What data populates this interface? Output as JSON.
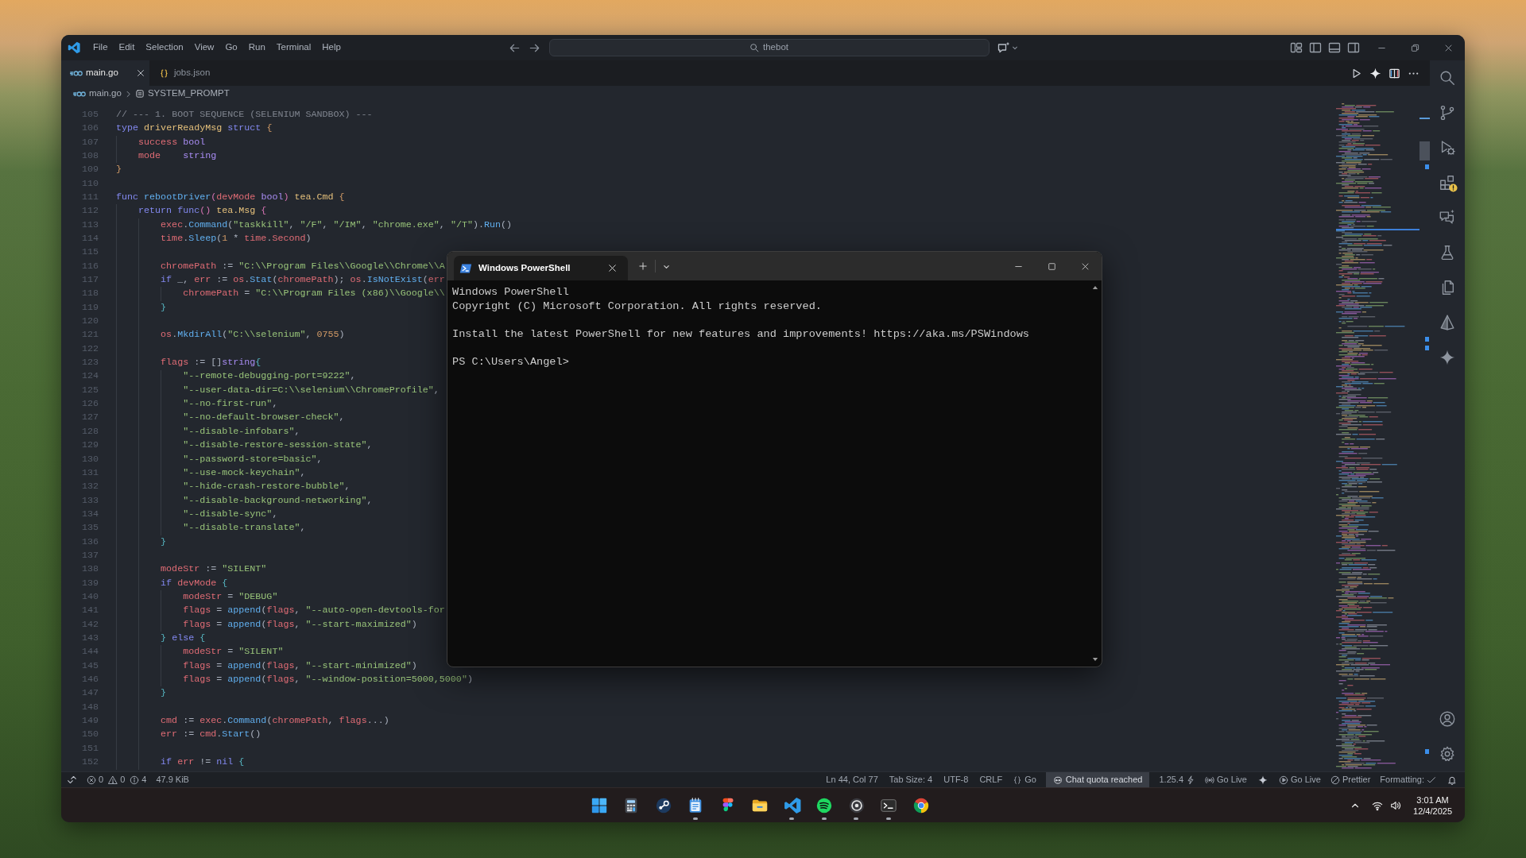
{
  "title_bar": {
    "menu": [
      "File",
      "Edit",
      "Selection",
      "View",
      "Go",
      "Run",
      "Terminal",
      "Help"
    ],
    "command_center": {
      "label": "thebot"
    }
  },
  "tabs": [
    {
      "label": "main.go",
      "kind": "go",
      "selected": true
    },
    {
      "label": "jobs.json",
      "kind": "json",
      "selected": false
    }
  ],
  "breadcrumb": [
    {
      "label": "main.go",
      "kind": "go"
    },
    {
      "label": "SYSTEM_PROMPT",
      "kind": "symbol"
    }
  ],
  "editor": {
    "lines": [
      {
        "number": "105",
        "tokens": [
          {
            "kind": "comment",
            "text": "// --- 1. BOOT SEQUENCE (SELENIUM SANDBOX) ---"
          }
        ]
      },
      {
        "number": "106",
        "tokens": [
          {
            "kind": "keyword",
            "text": "type "
          },
          {
            "kind": "type",
            "text": "driverReadyMsg "
          },
          {
            "kind": "keyword",
            "text": "struct "
          },
          {
            "kind": "bracket1",
            "text": "{"
          }
        ]
      },
      {
        "number": "107",
        "tokens": [
          {
            "kind": "variable",
            "text": "    success "
          },
          {
            "kind": "builtin",
            "text": "bool"
          }
        ]
      },
      {
        "number": "108",
        "tokens": [
          {
            "kind": "variable",
            "text": "    mode    "
          },
          {
            "kind": "builtin",
            "text": "string"
          }
        ]
      },
      {
        "number": "109",
        "tokens": [
          {
            "kind": "bracket1",
            "text": "}"
          }
        ]
      },
      {
        "number": "110"
      },
      {
        "number": "111",
        "tokens": [
          {
            "kind": "keyword",
            "text": "func "
          },
          {
            "kind": "function",
            "text": "rebootDriver"
          },
          {
            "kind": "bracket2",
            "text": "("
          },
          {
            "kind": "variable",
            "text": "devMode "
          },
          {
            "kind": "builtin",
            "text": "bool"
          },
          {
            "kind": "bracket2",
            "text": ") "
          },
          {
            "kind": "type",
            "text": "tea.Cmd "
          },
          {
            "kind": "bracket1",
            "text": "{"
          }
        ]
      },
      {
        "number": "112",
        "tokens": [
          {
            "kind": "keyword",
            "text": "    return func"
          },
          {
            "kind": "bracket2",
            "text": "() "
          },
          {
            "kind": "type",
            "text": "tea.Msg "
          },
          {
            "kind": "bracket2",
            "text": "{"
          }
        ]
      },
      {
        "number": "113",
        "tokens": [
          {
            "kind": "variable",
            "text": "        exec"
          },
          {
            "kind": "punctuation",
            "text": "."
          },
          {
            "kind": "function",
            "text": "Command"
          },
          {
            "kind": "punctuation",
            "text": "("
          },
          {
            "kind": "string",
            "text": "\"taskkill\""
          },
          {
            "kind": "punctuation",
            "text": ", "
          },
          {
            "kind": "string",
            "text": "\"/F\""
          },
          {
            "kind": "punctuation",
            "text": ", "
          },
          {
            "kind": "string",
            "text": "\"/IM\""
          },
          {
            "kind": "punctuation",
            "text": ", "
          },
          {
            "kind": "string",
            "text": "\"chrome.exe\""
          },
          {
            "kind": "punctuation",
            "text": ", "
          },
          {
            "kind": "string",
            "text": "\"/T\""
          },
          {
            "kind": "punctuation",
            "text": ")."
          },
          {
            "kind": "function",
            "text": "Run"
          },
          {
            "kind": "punctuation",
            "text": "()"
          }
        ]
      },
      {
        "number": "114",
        "tokens": [
          {
            "kind": "variable",
            "text": "        time"
          },
          {
            "kind": "punctuation",
            "text": "."
          },
          {
            "kind": "function",
            "text": "Sleep"
          },
          {
            "kind": "punctuation",
            "text": "("
          },
          {
            "kind": "number",
            "text": "1"
          },
          {
            "kind": "punctuation",
            "text": " * "
          },
          {
            "kind": "variable",
            "text": "time"
          },
          {
            "kind": "punctuation",
            "text": "."
          },
          {
            "kind": "variable",
            "text": "Second"
          },
          {
            "kind": "punctuation",
            "text": ")"
          }
        ]
      },
      {
        "number": "115"
      },
      {
        "number": "116",
        "tokens": [
          {
            "kind": "variable",
            "text": "        chromePath "
          },
          {
            "kind": "punctuation",
            "text": ":= "
          },
          {
            "kind": "string",
            "text": "\"C:\\\\Program Files\\\\Google\\\\Chrome\\\\A"
          }
        ]
      },
      {
        "number": "117",
        "tokens": [
          {
            "kind": "keyword",
            "text": "        if "
          },
          {
            "kind": "punctuation",
            "text": "_, "
          },
          {
            "kind": "variable",
            "text": "err "
          },
          {
            "kind": "punctuation",
            "text": ":= "
          },
          {
            "kind": "variable",
            "text": "os"
          },
          {
            "kind": "punctuation",
            "text": "."
          },
          {
            "kind": "function",
            "text": "Stat"
          },
          {
            "kind": "punctuation",
            "text": "("
          },
          {
            "kind": "variable",
            "text": "chromePath"
          },
          {
            "kind": "punctuation",
            "text": "); "
          },
          {
            "kind": "variable",
            "text": "os"
          },
          {
            "kind": "punctuation",
            "text": "."
          },
          {
            "kind": "function",
            "text": "IsNotExist"
          },
          {
            "kind": "punctuation",
            "text": "("
          },
          {
            "kind": "variable",
            "text": "err"
          }
        ]
      },
      {
        "number": "118",
        "tokens": [
          {
            "kind": "variable",
            "text": "            chromePath "
          },
          {
            "kind": "punctuation",
            "text": "= "
          },
          {
            "kind": "string",
            "text": "\"C:\\\\Program Files (x86)\\\\Google\\\\"
          }
        ]
      },
      {
        "number": "119",
        "tokens": [
          {
            "kind": "bracket3",
            "text": "        }"
          }
        ]
      },
      {
        "number": "120"
      },
      {
        "number": "121",
        "tokens": [
          {
            "kind": "variable",
            "text": "        os"
          },
          {
            "kind": "punctuation",
            "text": "."
          },
          {
            "kind": "function",
            "text": "MkdirAll"
          },
          {
            "kind": "punctuation",
            "text": "("
          },
          {
            "kind": "string",
            "text": "\"C:\\\\selenium\""
          },
          {
            "kind": "punctuation",
            "text": ", "
          },
          {
            "kind": "number",
            "text": "0755"
          },
          {
            "kind": "punctuation",
            "text": ")"
          }
        ]
      },
      {
        "number": "122"
      },
      {
        "number": "123",
        "tokens": [
          {
            "kind": "variable",
            "text": "        flags "
          },
          {
            "kind": "punctuation",
            "text": ":= []"
          },
          {
            "kind": "builtin",
            "text": "string"
          },
          {
            "kind": "bracket3",
            "text": "{"
          }
        ]
      },
      {
        "number": "124",
        "tokens": [
          {
            "kind": "string",
            "text": "            \"--remote-debugging-port=9222\""
          },
          {
            "kind": "punctuation",
            "text": ","
          }
        ]
      },
      {
        "number": "125",
        "tokens": [
          {
            "kind": "string",
            "text": "            \"--user-data-dir=C:\\\\selenium\\\\ChromeProfile\""
          },
          {
            "kind": "punctuation",
            "text": ","
          }
        ]
      },
      {
        "number": "126",
        "tokens": [
          {
            "kind": "string",
            "text": "            \"--no-first-run\""
          },
          {
            "kind": "punctuation",
            "text": ","
          }
        ]
      },
      {
        "number": "127",
        "tokens": [
          {
            "kind": "string",
            "text": "            \"--no-default-browser-check\""
          },
          {
            "kind": "punctuation",
            "text": ","
          }
        ]
      },
      {
        "number": "128",
        "tokens": [
          {
            "kind": "string",
            "text": "            \"--disable-infobars\""
          },
          {
            "kind": "punctuation",
            "text": ","
          }
        ]
      },
      {
        "number": "129",
        "tokens": [
          {
            "kind": "string",
            "text": "            \"--disable-restore-session-state\""
          },
          {
            "kind": "punctuation",
            "text": ","
          }
        ]
      },
      {
        "number": "130",
        "tokens": [
          {
            "kind": "string",
            "text": "            \"--password-store=basic\""
          },
          {
            "kind": "punctuation",
            "text": ","
          }
        ]
      },
      {
        "number": "131",
        "tokens": [
          {
            "kind": "string",
            "text": "            \"--use-mock-keychain\""
          },
          {
            "kind": "punctuation",
            "text": ","
          }
        ]
      },
      {
        "number": "132",
        "tokens": [
          {
            "kind": "string",
            "text": "            \"--hide-crash-restore-bubble\""
          },
          {
            "kind": "punctuation",
            "text": ","
          }
        ]
      },
      {
        "number": "133",
        "tokens": [
          {
            "kind": "string",
            "text": "            \"--disable-background-networking\""
          },
          {
            "kind": "punctuation",
            "text": ","
          }
        ]
      },
      {
        "number": "134",
        "tokens": [
          {
            "kind": "string",
            "text": "            \"--disable-sync\""
          },
          {
            "kind": "punctuation",
            "text": ","
          }
        ]
      },
      {
        "number": "135",
        "tokens": [
          {
            "kind": "string",
            "text": "            \"--disable-translate\""
          },
          {
            "kind": "punctuation",
            "text": ","
          }
        ]
      },
      {
        "number": "136",
        "tokens": [
          {
            "kind": "bracket3",
            "text": "        }"
          }
        ]
      },
      {
        "number": "137"
      },
      {
        "number": "138",
        "tokens": [
          {
            "kind": "variable",
            "text": "        modeStr "
          },
          {
            "kind": "punctuation",
            "text": ":= "
          },
          {
            "kind": "string",
            "text": "\"SILENT\""
          }
        ]
      },
      {
        "number": "139",
        "tokens": [
          {
            "kind": "keyword",
            "text": "        if "
          },
          {
            "kind": "variable",
            "text": "devMode "
          },
          {
            "kind": "bracket3",
            "text": "{"
          }
        ]
      },
      {
        "number": "140",
        "tokens": [
          {
            "kind": "variable",
            "text": "            modeStr "
          },
          {
            "kind": "punctuation",
            "text": "= "
          },
          {
            "kind": "string",
            "text": "\"DEBUG\""
          }
        ]
      },
      {
        "number": "141",
        "tokens": [
          {
            "kind": "variable",
            "text": "            flags "
          },
          {
            "kind": "punctuation",
            "text": "= "
          },
          {
            "kind": "function",
            "text": "append"
          },
          {
            "kind": "punctuation",
            "text": "("
          },
          {
            "kind": "variable",
            "text": "flags"
          },
          {
            "kind": "punctuation",
            "text": ", "
          },
          {
            "kind": "string",
            "text": "\"--auto-open-devtools-for"
          }
        ]
      },
      {
        "number": "142",
        "tokens": [
          {
            "kind": "variable",
            "text": "            flags "
          },
          {
            "kind": "punctuation",
            "text": "= "
          },
          {
            "kind": "function",
            "text": "append"
          },
          {
            "kind": "punctuation",
            "text": "("
          },
          {
            "kind": "variable",
            "text": "flags"
          },
          {
            "kind": "punctuation",
            "text": ", "
          },
          {
            "kind": "string",
            "text": "\"--start-maximized\""
          },
          {
            "kind": "punctuation",
            "text": ")"
          }
        ]
      },
      {
        "number": "143",
        "tokens": [
          {
            "kind": "bracket3",
            "text": "        } "
          },
          {
            "kind": "keyword",
            "text": "else "
          },
          {
            "kind": "bracket3",
            "text": "{"
          }
        ]
      },
      {
        "number": "144",
        "tokens": [
          {
            "kind": "variable",
            "text": "            modeStr "
          },
          {
            "kind": "punctuation",
            "text": "= "
          },
          {
            "kind": "string",
            "text": "\"SILENT\""
          }
        ]
      },
      {
        "number": "145",
        "tokens": [
          {
            "kind": "variable",
            "text": "            flags "
          },
          {
            "kind": "punctuation",
            "text": "= "
          },
          {
            "kind": "function",
            "text": "append"
          },
          {
            "kind": "punctuation",
            "text": "("
          },
          {
            "kind": "variable",
            "text": "flags"
          },
          {
            "kind": "punctuation",
            "text": ", "
          },
          {
            "kind": "string",
            "text": "\"--start-minimized\""
          },
          {
            "kind": "punctuation",
            "text": ")"
          }
        ]
      },
      {
        "number": "146",
        "tokens": [
          {
            "kind": "variable",
            "text": "            flags "
          },
          {
            "kind": "punctuation",
            "text": "= "
          },
          {
            "kind": "function",
            "text": "append"
          },
          {
            "kind": "punctuation",
            "text": "("
          },
          {
            "kind": "variable",
            "text": "flags"
          },
          {
            "kind": "punctuation",
            "text": ", "
          },
          {
            "kind": "string",
            "text": "\"--window-position=5000,5000\""
          },
          {
            "kind": "punctuation",
            "text": ")"
          }
        ]
      },
      {
        "number": "147",
        "tokens": [
          {
            "kind": "bracket3",
            "text": "        }"
          }
        ]
      },
      {
        "number": "148"
      },
      {
        "number": "149",
        "tokens": [
          {
            "kind": "variable",
            "text": "        cmd "
          },
          {
            "kind": "punctuation",
            "text": ":= "
          },
          {
            "kind": "variable",
            "text": "exec"
          },
          {
            "kind": "punctuation",
            "text": "."
          },
          {
            "kind": "function",
            "text": "Command"
          },
          {
            "kind": "punctuation",
            "text": "("
          },
          {
            "kind": "variable",
            "text": "chromePath"
          },
          {
            "kind": "punctuation",
            "text": ", "
          },
          {
            "kind": "variable",
            "text": "flags"
          },
          {
            "kind": "punctuation",
            "text": "...)"
          }
        ]
      },
      {
        "number": "150",
        "tokens": [
          {
            "kind": "variable",
            "text": "        err "
          },
          {
            "kind": "punctuation",
            "text": ":= "
          },
          {
            "kind": "variable",
            "text": "cmd"
          },
          {
            "kind": "punctuation",
            "text": "."
          },
          {
            "kind": "function",
            "text": "Start"
          },
          {
            "kind": "punctuation",
            "text": "()"
          }
        ]
      },
      {
        "number": "151"
      },
      {
        "number": "152",
        "tokens": [
          {
            "kind": "keyword",
            "text": "        if "
          },
          {
            "kind": "variable",
            "text": "err "
          },
          {
            "kind": "punctuation",
            "text": "!= "
          },
          {
            "kind": "keyword",
            "text": "nil "
          },
          {
            "kind": "bracket3",
            "text": "{"
          }
        ]
      }
    ]
  },
  "terminal_window": {
    "tab": {
      "title": "Windows PowerShell"
    },
    "output": [
      {
        "lines": [
          "Windows PowerShell",
          "Copyright (C) Microsoft Corporation. All rights reserved."
        ]
      },
      {
        "lines": [
          "Install the latest PowerShell for new features and improvements! https://aka.ms/PSWindows"
        ]
      },
      {
        "lines": [
          "PS C:\\Users\\Angel>"
        ]
      }
    ]
  },
  "status_bar": {
    "left": [
      {
        "kind": "remote"
      },
      {
        "kind": "problems",
        "errors": "0",
        "warnings": "0",
        "infos": "4"
      },
      {
        "kind": "text",
        "text": "47.9 KiB"
      }
    ],
    "right": [
      {
        "kind": "text",
        "text": "Ln 44, Col 77"
      },
      {
        "kind": "text",
        "text": "Tab Size: 4"
      },
      {
        "kind": "text",
        "text": "UTF-8"
      },
      {
        "kind": "text",
        "text": "CRLF"
      },
      {
        "kind": "language",
        "text": "Go"
      },
      {
        "kind": "alert",
        "text": "Chat quota reached"
      },
      {
        "kind": "version",
        "text": "1.25.4"
      },
      {
        "kind": "broadcast",
        "text": "Go Live"
      },
      {
        "kind": "sparkle"
      },
      {
        "kind": "server",
        "text": "Go Live"
      },
      {
        "kind": "formatter",
        "text": "Prettier"
      },
      {
        "kind": "formatting",
        "text": "Formatting:"
      },
      {
        "kind": "bell"
      }
    ]
  },
  "taskbar": {
    "apps": [
      {
        "kind": "start",
        "running": false
      },
      {
        "kind": "calculator",
        "running": false
      },
      {
        "kind": "disc",
        "running": false
      },
      {
        "kind": "notepad",
        "running": true
      },
      {
        "kind": "shapes",
        "running": false
      },
      {
        "kind": "folder",
        "running": false
      },
      {
        "kind": "ribbon",
        "running": true
      },
      {
        "kind": "waves",
        "running": true
      },
      {
        "kind": "ring",
        "running": true
      },
      {
        "kind": "terminal",
        "running": true
      },
      {
        "kind": "globe",
        "running": false
      }
    ],
    "clock": {
      "time": "3:01 AM",
      "date": "12/4/2025"
    }
  }
}
